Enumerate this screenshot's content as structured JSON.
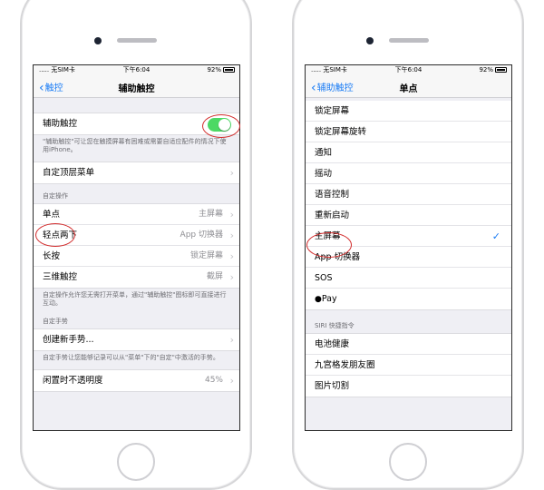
{
  "status_bar": {
    "carrier": "..... 无SIM卡",
    "time": "下午6:04",
    "battery": "92%"
  },
  "left": {
    "back_label": "触控",
    "title": "辅助触控",
    "assistive_touch_label": "辅助触控",
    "assistive_touch_on": true,
    "assistive_touch_desc": "\"辅助触控\"可让您在触摸屏幕有困难或需要自适应配件的情况下使用iPhone。",
    "customize_menu": "自定顶层菜单",
    "custom_actions_header": "自定操作",
    "actions": [
      {
        "label": "单点",
        "value": "主屏幕"
      },
      {
        "label": "轻点两下",
        "value": "App 切换器"
      },
      {
        "label": "长按",
        "value": "锁定屏幕"
      },
      {
        "label": "三维触控",
        "value": "截屏"
      }
    ],
    "custom_actions_desc": "自定操作允许您无需打开菜单，通过\"辅助触控\"图标即可直接进行互动。",
    "custom_gestures_header": "自定手势",
    "create_gesture": "创建新手势...",
    "gestures_desc": "自定手势让您能够记录可以从\"菜单\"下的\"自定\"中激活的手势。",
    "idle_opacity_label": "闲置时不透明度",
    "idle_opacity_value": "45%"
  },
  "right": {
    "back_label": "辅助触控",
    "title": "单点",
    "options": [
      {
        "label": "锁定屏幕",
        "selected": false
      },
      {
        "label": "锁定屏幕旋转",
        "selected": false
      },
      {
        "label": "通知",
        "selected": false
      },
      {
        "label": "摇动",
        "selected": false
      },
      {
        "label": "语音控制",
        "selected": false
      },
      {
        "label": "重新启动",
        "selected": false
      },
      {
        "label": "主屏幕",
        "selected": true
      },
      {
        "label": "App 切换器",
        "selected": false
      },
      {
        "label": "SOS",
        "selected": false
      },
      {
        "label": "Pay",
        "selected": false
      }
    ],
    "siri_header": "SIRI 快捷指令",
    "siri_items": [
      "电池健康",
      "九宫格发朋友圈",
      "图片切割"
    ]
  },
  "colors": {
    "accent": "#1a7cf5",
    "toggle_on": "#4cd964",
    "annotation": "#d22b2b"
  }
}
